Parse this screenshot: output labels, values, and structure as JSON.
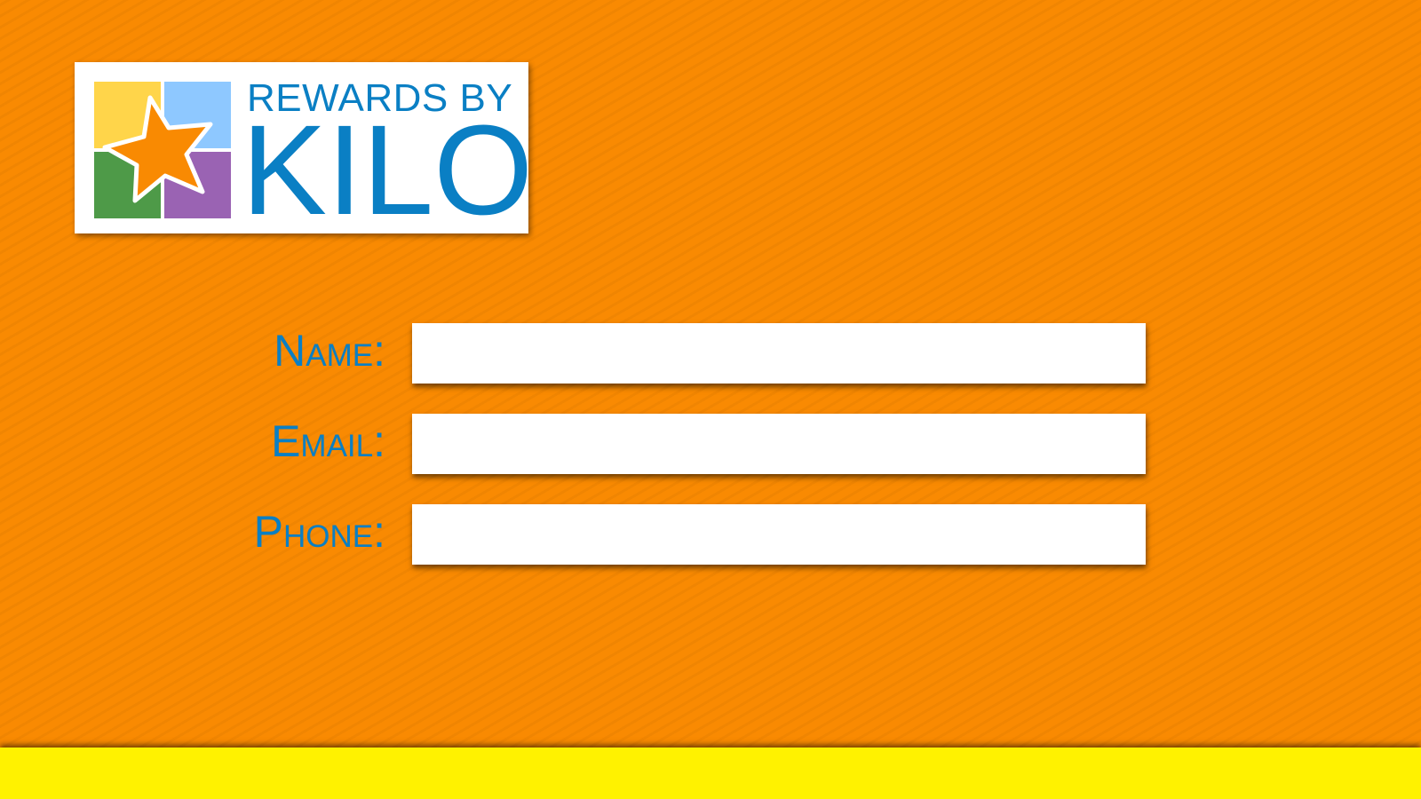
{
  "logo": {
    "line1": "REWARDS BY",
    "line2": "KILO",
    "icon": "star-quad-icon",
    "colors": {
      "tile_yellow": "#ffd54a",
      "tile_blue": "#8ec8ff",
      "tile_green": "#4e9a48",
      "tile_purple": "#9a63b3",
      "star": "#f98a02",
      "text": "#0a7fc4"
    }
  },
  "form": {
    "fields": [
      {
        "label": "Name:",
        "value": "",
        "placeholder": ""
      },
      {
        "label": "Email:",
        "value": "",
        "placeholder": ""
      },
      {
        "label": "Phone:",
        "value": "",
        "placeholder": ""
      }
    ]
  },
  "theme": {
    "background": "#f98a02",
    "footer": "#fff200",
    "label_color": "#0a7fc4"
  }
}
